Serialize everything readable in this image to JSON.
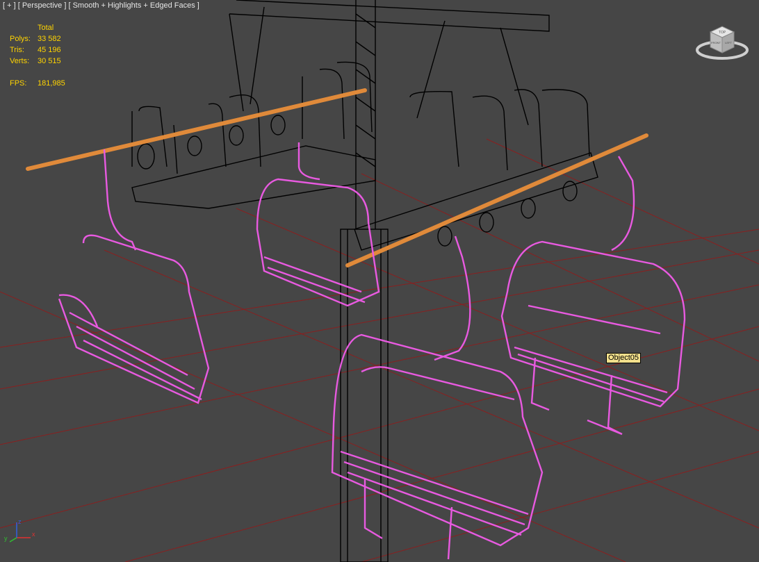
{
  "viewport": {
    "label_parts": [
      "[ + ]",
      "[ Perspective ]",
      "[ Smooth + Highlights + Edged Faces ]"
    ]
  },
  "stats": {
    "header": "Total",
    "polys_label": "Polys:",
    "polys_value": "33 582",
    "tris_label": "Tris:",
    "tris_value": "45 196",
    "verts_label": "Verts:",
    "verts_value": "30 515",
    "fps_label": "FPS:",
    "fps_value": "181,985"
  },
  "tooltip": {
    "text": "Object05"
  },
  "viewcube": {
    "top_label": "TOP",
    "front_label": "FRONT",
    "left_label": "LEFT"
  },
  "axes": {
    "x": "x",
    "y": "y",
    "z": "z"
  },
  "colors": {
    "background": "#464646",
    "grid": "#8a1f1f",
    "selected_wire": "#e85ae0",
    "cable": "#e08a3a",
    "structure": "#000000",
    "stats_text": "#ffd400"
  }
}
